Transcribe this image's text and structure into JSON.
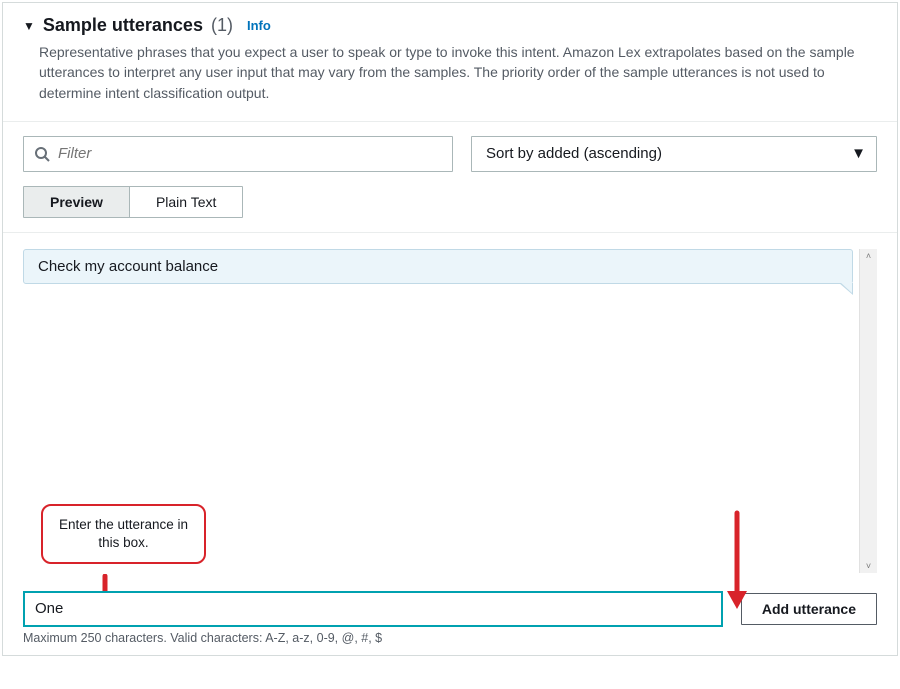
{
  "header": {
    "title": "Sample utterances",
    "count": "(1)",
    "info_label": "Info",
    "description": "Representative phrases that you expect a user to speak or type to invoke this intent. Amazon Lex extrapolates based on the sample utterances to interpret any user input that may vary from the samples. The priority order of the sample utterances is not used to determine intent classification output."
  },
  "controls": {
    "filter_placeholder": "Filter",
    "sort_label": "Sort by added (ascending)",
    "toggle": {
      "preview": "Preview",
      "plaintext": "Plain Text"
    }
  },
  "utterances": [
    {
      "text": "Check my account balance"
    }
  ],
  "callout": {
    "text": "Enter the utterance in this box."
  },
  "entry": {
    "input_value": "One",
    "add_button": "Add utterance",
    "hint": "Maximum 250 characters. Valid characters: A-Z, a-z, 0-9, @, #, $"
  }
}
